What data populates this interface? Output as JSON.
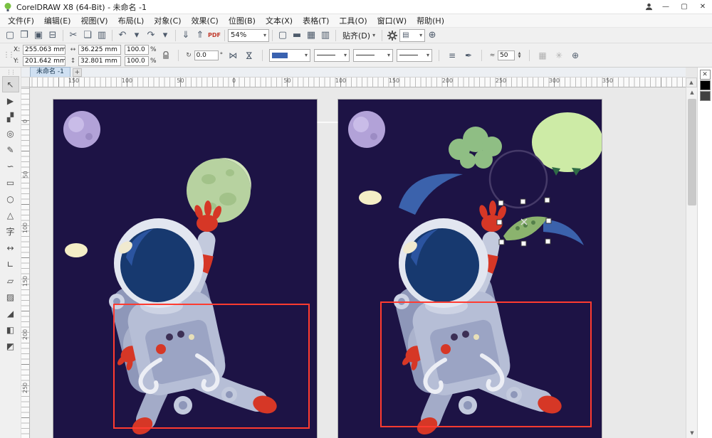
{
  "window": {
    "title": "CorelDRAW X8 (64-Bit) - 未命名 -1",
    "minimize_label": "—",
    "maximize_label": "▢",
    "close_label": "✕"
  },
  "menu": {
    "items": [
      {
        "label": "文件(F)"
      },
      {
        "label": "编辑(E)"
      },
      {
        "label": "视图(V)"
      },
      {
        "label": "布局(L)"
      },
      {
        "label": "对象(C)"
      },
      {
        "label": "效果(C)"
      },
      {
        "label": "位图(B)"
      },
      {
        "label": "文本(X)"
      },
      {
        "label": "表格(T)"
      },
      {
        "label": "工具(O)"
      },
      {
        "label": "窗口(W)"
      },
      {
        "label": "帮助(H)"
      }
    ]
  },
  "standard_toolbar": {
    "file_icons": [
      {
        "name": "new-document-icon",
        "glyph": "▢"
      },
      {
        "name": "open-icon",
        "glyph": "❒"
      },
      {
        "name": "save-icon",
        "glyph": "▣"
      },
      {
        "name": "print-icon",
        "glyph": "⊟"
      }
    ],
    "edit_icons": [
      {
        "name": "cut-icon",
        "glyph": "✂"
      },
      {
        "name": "copy-icon",
        "glyph": "❏"
      },
      {
        "name": "paste-icon",
        "glyph": "▥"
      }
    ],
    "history_icons": [
      {
        "name": "undo-icon",
        "glyph": "↶"
      },
      {
        "name": "undo-dropdown-icon",
        "glyph": "▾"
      },
      {
        "name": "redo-icon",
        "glyph": "↷"
      },
      {
        "name": "redo-dropdown-icon",
        "glyph": "▾"
      }
    ],
    "io_icons": [
      {
        "name": "import-icon",
        "glyph": "⇓"
      },
      {
        "name": "export-icon",
        "glyph": "⇑"
      },
      {
        "name": "publish-pdf-icon",
        "glyph": "PDF"
      }
    ],
    "zoom_value": "54%",
    "view_icons": [
      {
        "name": "fullscreen-preview-icon",
        "glyph": "▢"
      },
      {
        "name": "show-rulers-icon",
        "glyph": "▬"
      },
      {
        "name": "show-grid-icon",
        "glyph": "▦"
      },
      {
        "name": "show-guidelines-icon",
        "glyph": "▥"
      }
    ],
    "snap_label": "贴齐(D)"
  },
  "property_bar": {
    "x_label": "X:",
    "x_value": "255.063 mm",
    "y_label": "Y:",
    "y_value": "201.642 mm",
    "width_value": "36.225 mm",
    "height_value": "32.801 mm",
    "scale_h_value": "100.0",
    "scale_v_value": "100.0",
    "percent_label": "%",
    "rotation_value": "0.0",
    "degree_label": "°",
    "smooth_value": "50"
  },
  "document": {
    "tab_label": "未命名 -1",
    "add_tab_label": "+"
  },
  "rulers": {
    "horizontal": [
      "150",
      "100",
      "50",
      "0",
      "50",
      "100",
      "150",
      "200",
      "250",
      "300",
      "350"
    ],
    "vertical": [
      "0",
      "50",
      "100",
      "150",
      "200",
      "250"
    ]
  },
  "toolbox": {
    "tools": [
      {
        "name": "pick-tool",
        "glyph": "↖"
      },
      {
        "name": "shape-tool",
        "glyph": "▶"
      },
      {
        "name": "crop-tool",
        "glyph": "▞"
      },
      {
        "name": "zoom-tool",
        "glyph": "◎"
      },
      {
        "name": "freehand-tool",
        "glyph": "✎"
      },
      {
        "name": "artistic-media-tool",
        "glyph": "∽"
      },
      {
        "name": "rectangle-tool",
        "glyph": "▭"
      },
      {
        "name": "ellipse-tool",
        "glyph": "○"
      },
      {
        "name": "polygon-tool",
        "glyph": "△"
      },
      {
        "name": "text-tool",
        "glyph": "字"
      },
      {
        "name": "parallel-dimension-tool",
        "glyph": "↔"
      },
      {
        "name": "connector-tool",
        "glyph": "∟"
      },
      {
        "name": "drop-shadow-tool",
        "glyph": "▱"
      },
      {
        "name": "transparency-tool",
        "glyph": "▨"
      },
      {
        "name": "color-eyedropper-tool",
        "glyph": "◢"
      },
      {
        "name": "interactive-fill-tool",
        "glyph": "◧"
      },
      {
        "name": "smart-fill-tool",
        "glyph": "◩"
      }
    ]
  },
  "palette": {
    "swatches": [
      {
        "name": "no-color-swatch",
        "color": "#ffffff",
        "glyph": "✕"
      },
      {
        "name": "black-swatch",
        "color": "#000000",
        "glyph": ""
      },
      {
        "name": "dark-gray-swatch",
        "color": "#404040",
        "glyph": ""
      }
    ]
  },
  "ui": {
    "caret": "▾",
    "up_arrow": "▲",
    "down_arrow": "▼",
    "h_arrow": "↔",
    "v_arrow": "↕",
    "rotate_glyph": "↻",
    "mirror_glyph": "⋈",
    "approx_glyph": "≈",
    "wrap_text_glyph": "≡",
    "outline_pen_glyph": "✒",
    "plus_glyph": "⊕",
    "outline_preview_color": "#3a62b0"
  },
  "artwork": {
    "page_background": "#1d1345",
    "selection_rect_color": "#ff3b30",
    "suit_color": "#b6bed6",
    "accent_red": "#d63726",
    "visor_color": "#17396f",
    "moon_green": "#b7d2a0",
    "moon_purple": "#b2a2d8",
    "blob_light_green": "#cdeba6",
    "cloud_green": "#8fbe84",
    "swoosh_blue": "#3b62ac",
    "cream": "#f4eec6"
  }
}
